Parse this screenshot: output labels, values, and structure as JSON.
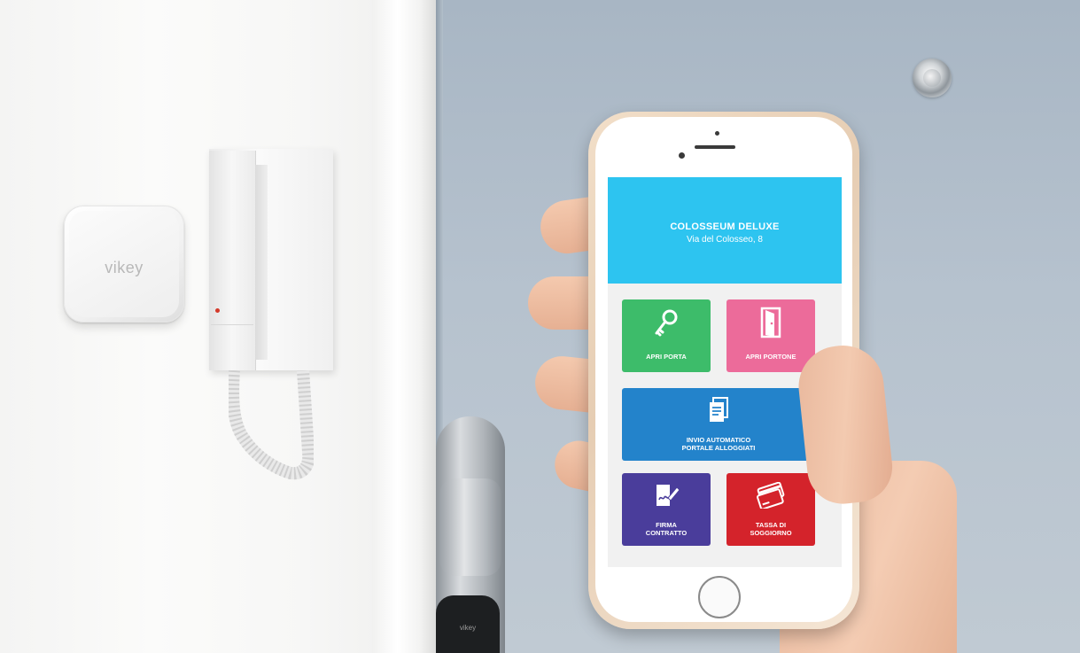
{
  "device": {
    "brand_label": "vikey",
    "lock_label": "vikey"
  },
  "app": {
    "property_name": "COLOSSEUM DELUXE",
    "property_address": "Via del Colosseo, 8",
    "tiles": {
      "apri_porta": {
        "label": "APRI PORTA",
        "icon": "key-icon",
        "color": "#3dbc6a"
      },
      "apri_portone": {
        "label": "APRI PORTONE",
        "icon": "door-icon",
        "color": "#ec6b9a"
      },
      "invio": {
        "label_line1": "INVIO AUTOMATICO",
        "label_line2": "PORTALE ALLOGGIATI",
        "icon": "document-icon",
        "color": "#2383cb"
      },
      "firma": {
        "label_line1": "FIRMA",
        "label_line2": "CONTRATTO",
        "icon": "signature-icon",
        "color": "#4a3d9b"
      },
      "tassa": {
        "label_line1": "TASSA DI",
        "label_line2": "SOGGIORNO",
        "icon": "credit-card-icon",
        "color": "#d4232b"
      }
    },
    "header_color": "#2dc4f0"
  }
}
